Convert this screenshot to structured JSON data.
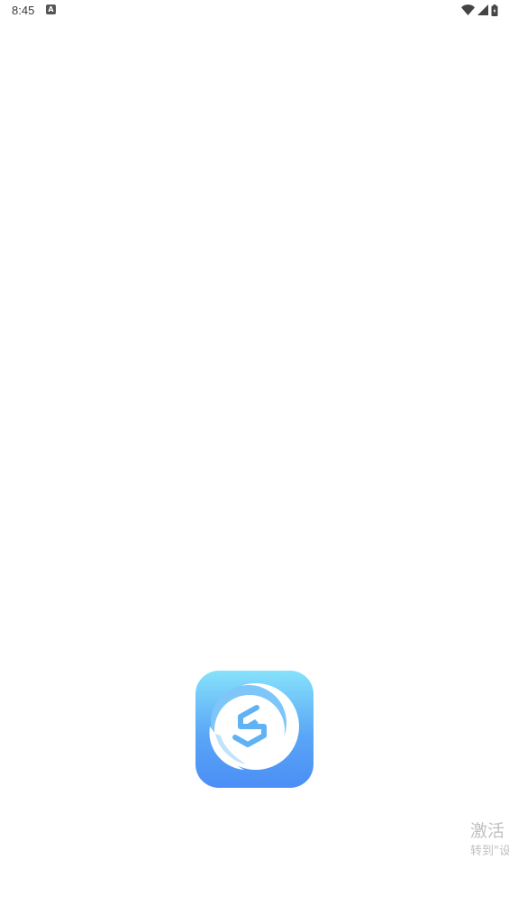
{
  "status_bar": {
    "time": "8:45",
    "notification_icon": "android-notification-icon",
    "right_icons": [
      "wifi-icon",
      "signal-icon",
      "battery-icon"
    ]
  },
  "splash": {
    "logo_icon": "app-logo-icon",
    "logo_colors": {
      "top": "#86e2fb",
      "bottom": "#4b8ef5",
      "mark": "#5fb2f4"
    }
  },
  "watermark": {
    "title": "激活",
    "subtitle": "转到\"设"
  }
}
